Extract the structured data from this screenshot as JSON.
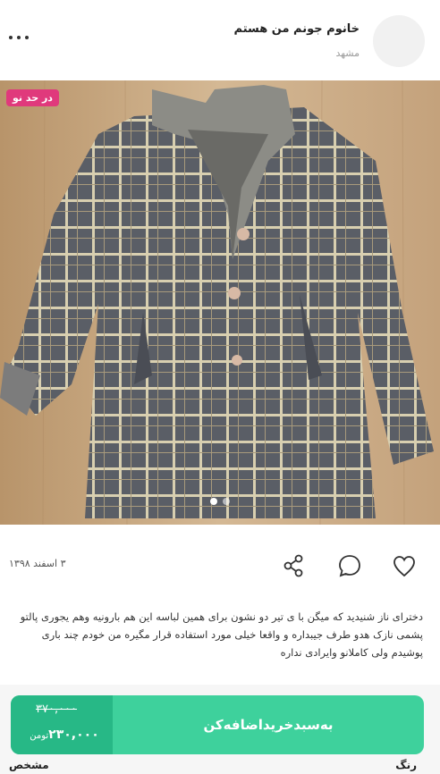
{
  "header": {
    "seller_name": "خانوم جونم من هستم",
    "city": "مشهد",
    "more_icon": "more-horizontal-icon"
  },
  "post": {
    "badge": "در حد نو",
    "image_count": 2,
    "active_image": 1,
    "date": "۳ اسفند ۱۳۹۸",
    "description": "دختر‌ای ناز شنیدید که میگن با ی تیر دو نشون برای همین لباسه این هم بارونیه وهم یجوری پالتو پشمی نازک هدو طرف جیبداره و واقعا خیلی مورد استفاده قرار مگیره من خودم چند باری پوشیدم ولی کاملانو وایرادی نداره"
  },
  "actions": {
    "share": "share-icon",
    "comment": "comment-icon",
    "like": "heart-icon"
  },
  "cart": {
    "add_label": "به‌سبد‌خرید‌اضافه‌کن",
    "old_price": "۳۷۰,۰۰۰",
    "new_price": "۲۳۰,۰۰۰",
    "currency": "تومن"
  },
  "specs": {
    "left": "مشخص",
    "right": "رنگ"
  },
  "colors": {
    "accent": "#3ed19c",
    "accent_dark": "#27b886",
    "badge": "#e0397c"
  }
}
